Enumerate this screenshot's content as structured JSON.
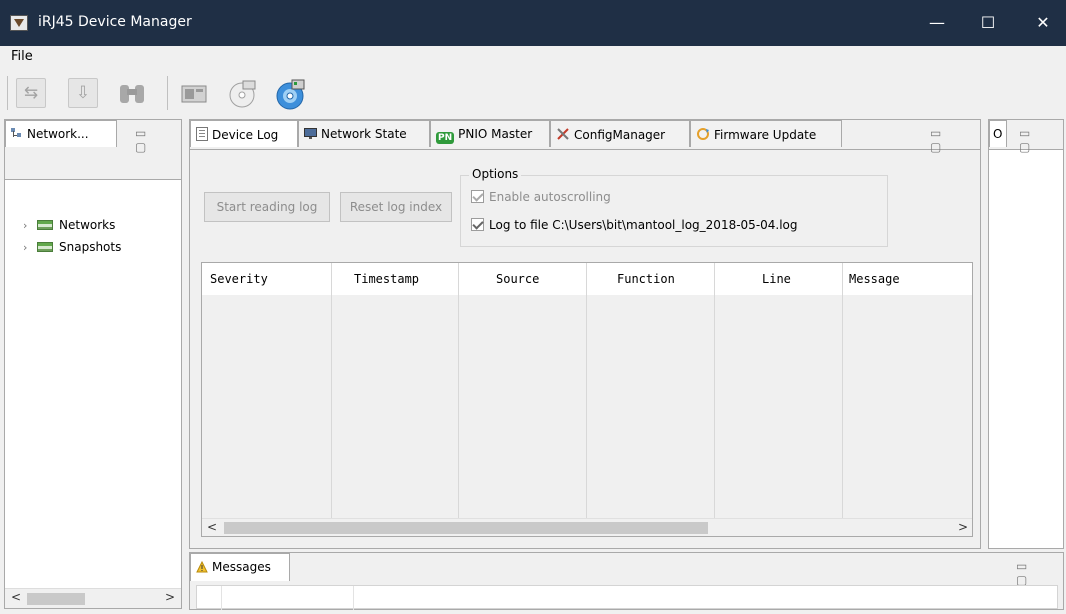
{
  "window": {
    "title": "iRJ45 Device Manager",
    "controls": {
      "minimize": "—",
      "maximize": "☐",
      "close": "✕"
    }
  },
  "menu": {
    "file": "File"
  },
  "toolbar": {
    "buttons": [
      {
        "name": "connect-icon",
        "glyph": "⇆"
      },
      {
        "name": "download-icon",
        "glyph": "⇩"
      },
      {
        "name": "binoculars-icon",
        "glyph": "⌘"
      },
      {
        "name": "card-icon",
        "glyph": "▦"
      },
      {
        "name": "lan-disc-icon",
        "glyph": "◎"
      },
      {
        "name": "firmware-disc-icon",
        "glyph": "◉"
      }
    ]
  },
  "navigator": {
    "tab_label": "Network...",
    "tree": [
      {
        "label": "Networks"
      },
      {
        "label": "Snapshots"
      }
    ]
  },
  "main_tabs": [
    {
      "label": "Device Log",
      "active": true
    },
    {
      "label": "Network State",
      "active": false
    },
    {
      "label": "PNIO Master",
      "badge": "PN",
      "active": false
    },
    {
      "label": "ConfigManager",
      "active": false
    },
    {
      "label": "Firmware Update",
      "active": false
    }
  ],
  "device_log": {
    "start_button": "Start reading log",
    "reset_button": "Reset log index",
    "options_title": "Options",
    "enable_autoscroll": "Enable autoscrolling",
    "log_to_file": "Log to file C:\\Users\\bit\\mantool_log_2018-05-04.log",
    "columns": [
      "Severity",
      "Timestamp",
      "Source",
      "Function",
      "Line",
      "Message"
    ]
  },
  "right_panel": {
    "tab_label": "O"
  },
  "messages": {
    "tab_label": "Messages"
  },
  "colors": {
    "titlebar": "#1f2f45",
    "pn_badge": "#2f9a3b",
    "firmware_disc": "#3d8fdb"
  }
}
